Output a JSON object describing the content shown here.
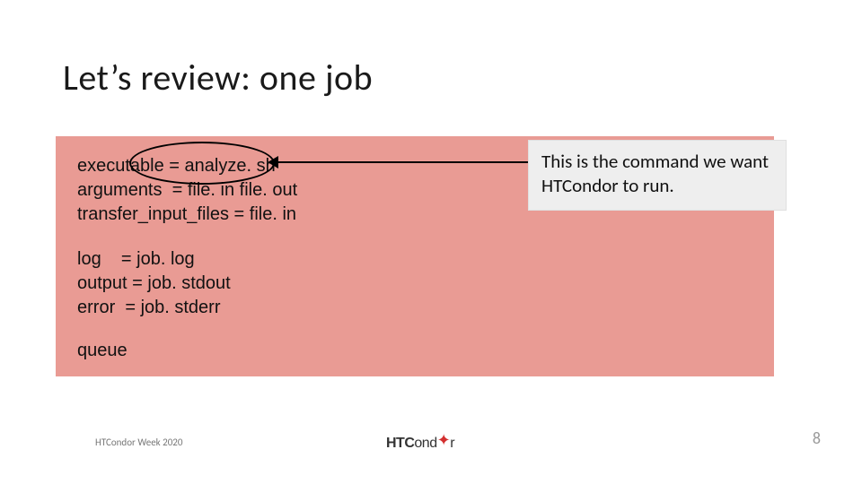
{
  "title": "Let’s review: one job",
  "code": {
    "block1": "executable = analyze. sh\narguments  = file. in file. out\ntransfer_input_files = file. in",
    "block2": "log    = job. log\noutput = job. stdout\nerror  = job. stderr",
    "block3": "queue"
  },
  "callout": "This is the command we want HTCondor to run.",
  "footer": {
    "left": "HTCondor Week 2020",
    "logo_prefix": "HTC",
    "logo_suffix": "ond",
    "logo_suffix2": "r",
    "page": "8"
  }
}
